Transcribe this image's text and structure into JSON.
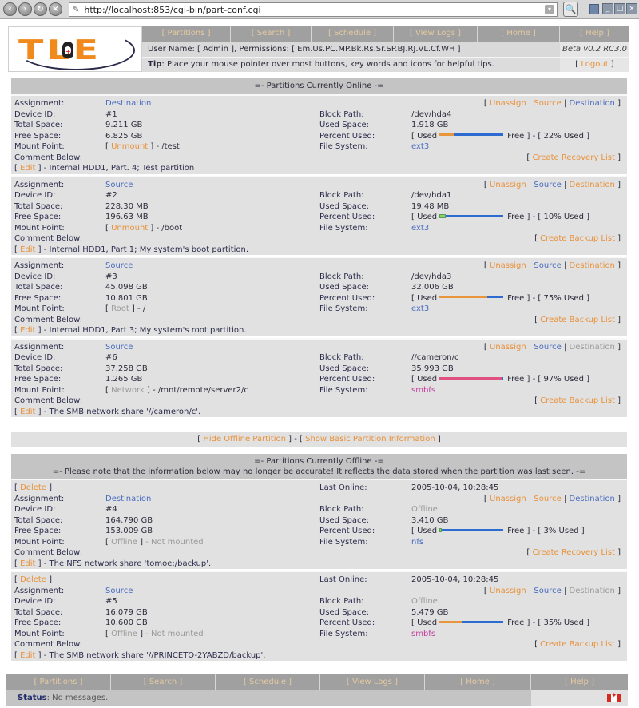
{
  "browser": {
    "url": "http://localhost:853/cgi-bin/part-conf.cgi"
  },
  "header": {
    "logo_text": "TLE",
    "nav": [
      "[ Partitions ]",
      "[ Search ]",
      "[ Schedule ]",
      "[ View Logs ]",
      "[ Home ]"
    ],
    "help": "[ Help ]",
    "user_line_prefix": "User Name: [ Admin ], Permissions: [ Em.Us.PC.MP.Bk.Rs.Sr.SP.BJ.RJ.VL.Cf.WH ]",
    "version": "Beta v0.2 RC3.0",
    "tip_label": "Tip",
    "tip_text": ": Place your mouse pointer over most buttons, key words and icons for helpful tips.",
    "logout": "Logout"
  },
  "labels": {
    "assignment": "Assignment:",
    "device_id": "Device ID:",
    "total_space": "Total Space:",
    "free_space": "Free Space:",
    "mount_point": "Mount Point:",
    "comment_below": "Comment Below:",
    "block_path": "Block Path:",
    "used_space": "Used Space:",
    "percent_used": "Percent Used:",
    "file_system": "File System:",
    "last_online": "Last Online:",
    "unassign": "Unassign",
    "source": "Source",
    "destination": "Destination",
    "edit": "Edit",
    "delete": "Delete",
    "used": "[ Used",
    "free": "Free ] - [ ",
    "used_suffix": "% Used ]"
  },
  "online": {
    "title": "=- Partitions Currently Online -=",
    "partitions": [
      {
        "assignment": "Destination",
        "device_id": "#1",
        "total_space": "9.211 GB",
        "free_space": "6.825 GB",
        "mount_action": "Unmount",
        "mount_path": "/test",
        "comment": "Internal HDD1, Part. 4; Test partition",
        "block_path": "/dev/hda4",
        "used_space": "1.918 GB",
        "percent_used": 22,
        "file_system": "ext3",
        "list_action": "Create Recovery List"
      },
      {
        "assignment": "Source",
        "device_id": "#2",
        "total_space": "228.30 MB",
        "free_space": "196.63 MB",
        "mount_action": "Unmount",
        "mount_path": "/boot",
        "comment": "Internal HDD1, Part 1; My system's boot partition.",
        "block_path": "/dev/hda1",
        "used_space": "19.48 MB",
        "percent_used": 10,
        "file_system": "ext3",
        "list_action": "Create Backup List"
      },
      {
        "assignment": "Source",
        "device_id": "#3",
        "total_space": "45.098 GB",
        "free_space": "10.801 GB",
        "mount_action": "Root",
        "mount_path": "/",
        "comment": "Internal HDD1, Part 3; My system's root partition.",
        "block_path": "/dev/hda3",
        "used_space": "32.006 GB",
        "percent_used": 75,
        "file_system": "ext3",
        "list_action": "Create Backup List"
      },
      {
        "assignment": "Source",
        "device_id": "#6",
        "total_space": "37.258 GB",
        "free_space": "1.265 GB",
        "mount_action": "Network",
        "mount_path": "/mnt/remote/server2/c",
        "comment": "The SMB network share '//cameron/c'.",
        "block_path": "//cameron/c",
        "used_space": "35.993 GB",
        "percent_used": 97,
        "file_system": "smbfs",
        "list_action": "Create Backup List"
      }
    ]
  },
  "middle": {
    "hide_offline": "Hide Offline Partition",
    "separator": "] - [",
    "show_basic": "Show Basic Partition Information"
  },
  "offline": {
    "title": "=- Partitions Currently Offline -=",
    "note": "=- Please note that the information below may no longer be accurate! It reflects the data stored when the partition was last seen. -=",
    "partitions": [
      {
        "last_online": "2005-10-04, 10:28:45",
        "assignment": "Destination",
        "device_id": "#4",
        "total_space": "164.790 GB",
        "free_space": "153.009 GB",
        "mount_action": "Offline",
        "mount_path": "Not mounted",
        "comment": "The NFS network share 'tomoe:/backup'.",
        "block_path": "Offline",
        "used_space": "3.410 GB",
        "percent_used": 3,
        "file_system": "nfs",
        "list_action": "Create Recovery List"
      },
      {
        "last_online": "2005-10-04, 10:28:45",
        "assignment": "Source",
        "device_id": "#5",
        "total_space": "16.079 GB",
        "free_space": "10.600 GB",
        "mount_action": "Offline",
        "mount_path": "Not mounted",
        "comment": "The SMB network share '//PRINCETO-2YABZD/backup'.",
        "block_path": "Offline",
        "used_space": "5.479 GB",
        "percent_used": 35,
        "file_system": "smbfs",
        "list_action": "Create Backup List"
      }
    ]
  },
  "footer": {
    "nav": [
      "[ Partitions ]",
      "[ Search ]",
      "[ Schedule ]",
      "[ View Logs ]",
      "[ Home ]"
    ],
    "help": "[ Help ]",
    "status_label": "Status",
    "status_text": ": No messages."
  },
  "colors": {
    "link_orange": "#e8913a",
    "link_blue": "#4a6cc0",
    "bar_used": "#e8963c",
    "bar_free": "#2e6bd0",
    "bar_critical": "#e05080"
  }
}
